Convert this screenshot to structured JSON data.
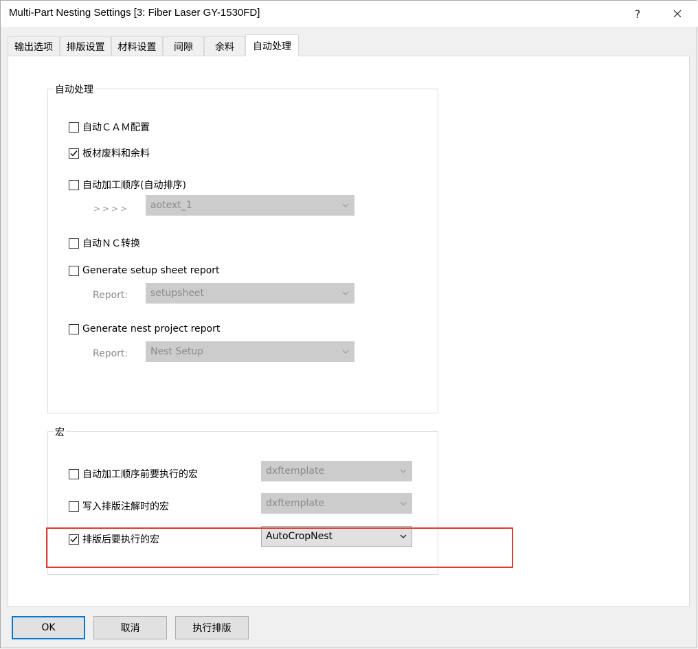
{
  "window": {
    "title": "Multi-Part Nesting Settings [3: Fiber Laser GY-1530FD]",
    "help_label": "?",
    "close_icon": "close-icon"
  },
  "tabs": [
    {
      "label": "输出选项"
    },
    {
      "label": "排版设置"
    },
    {
      "label": "材料设置"
    },
    {
      "label": "间隙"
    },
    {
      "label": "余料"
    },
    {
      "label": "自动处理"
    }
  ],
  "active_tab": "自动处理",
  "auto_group": {
    "title": "自动处理",
    "items": [
      {
        "label": "自动ＣＡＭ配置",
        "checked": false
      },
      {
        "label": "板材废料和余料",
        "checked": true
      },
      {
        "label": "自动加工顺序(自动排序)",
        "checked": false,
        "sub_prefix": ">>>>",
        "combo_value": "aotext_1"
      },
      {
        "label": "自动ＮＣ转换",
        "checked": false
      },
      {
        "label": "Generate setup sheet report",
        "checked": false,
        "sub_label": "Report:",
        "combo_value": "setupsheet"
      },
      {
        "label": "Generate nest project report",
        "checked": false,
        "sub_label": "Report:",
        "combo_value": "Nest Setup"
      }
    ]
  },
  "macro_group": {
    "title": "宏",
    "items": [
      {
        "label": "自动加工顺序前要执行的宏",
        "checked": false,
        "combo_value": "dxftemplate",
        "enabled": false
      },
      {
        "label": "写入排版注解时的宏",
        "checked": false,
        "combo_value": "dxftemplate",
        "enabled": false
      },
      {
        "label": "排版后要执行的宏",
        "checked": true,
        "combo_value": "AutoCropNest",
        "enabled": true
      }
    ]
  },
  "buttons": {
    "ok": "OK",
    "cancel": "取消",
    "run": "执行排版"
  },
  "colors": {
    "highlight": "#e53935",
    "default_button_border": "#0078d7"
  }
}
